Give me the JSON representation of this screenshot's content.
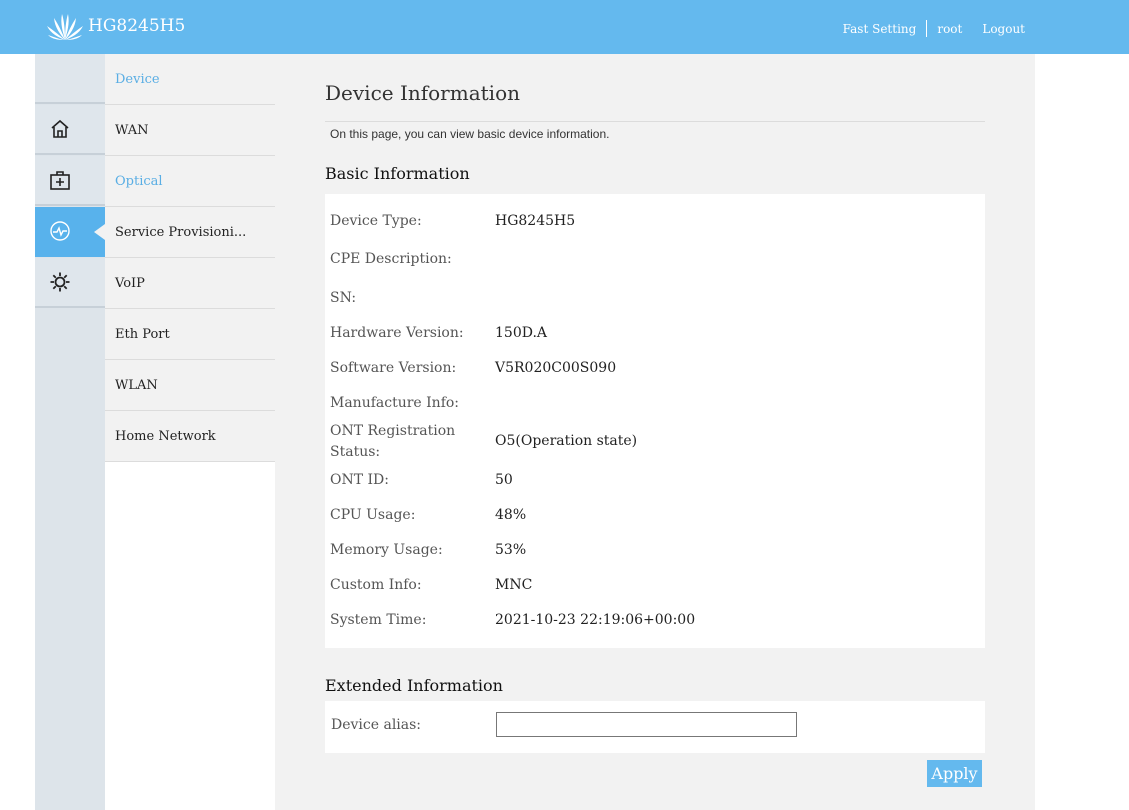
{
  "header": {
    "brand": "HG8245H5",
    "links": [
      "Fast Setting",
      "root",
      "Logout"
    ],
    "bg_color": "#64b9ee"
  },
  "icon_rail": [
    {
      "icon": "home-icon",
      "active": false
    },
    {
      "icon": "medical-kit-icon",
      "active": false
    },
    {
      "icon": "heartbeat-icon",
      "active": true
    },
    {
      "icon": "gear-icon",
      "active": false
    }
  ],
  "nav": {
    "items": [
      {
        "label": "Device",
        "highlight": true
      },
      {
        "label": "WAN",
        "highlight": false
      },
      {
        "label": "Optical",
        "highlight": true
      },
      {
        "label": "Service Provisioni...",
        "highlight": false
      },
      {
        "label": "VoIP",
        "highlight": false
      },
      {
        "label": "Eth Port",
        "highlight": false
      },
      {
        "label": "WLAN",
        "highlight": false
      },
      {
        "label": "Home Network",
        "highlight": false
      }
    ]
  },
  "page": {
    "title": "Device Information",
    "description": "On this page, you can view basic device information."
  },
  "basic": {
    "title": "Basic Information",
    "rows": [
      {
        "label": "Device Type:",
        "value": "HG8245H5"
      },
      {
        "label": "CPE Description:",
        "value": ""
      },
      {
        "label": "SN:",
        "value": ""
      },
      {
        "label": "Hardware Version:",
        "value": "150D.A"
      },
      {
        "label": "Software Version:",
        "value": "V5R020C00S090"
      },
      {
        "label": "Manufacture Info:",
        "value": ""
      },
      {
        "label": "ONT Registration Status:",
        "value": "O5(Operation state)"
      },
      {
        "label": "ONT ID:",
        "value": "50"
      },
      {
        "label": "CPU Usage:",
        "value": "48%"
      },
      {
        "label": "Memory Usage:",
        "value": "53%"
      },
      {
        "label": "Custom Info:",
        "value": "MNC"
      },
      {
        "label": "System Time:",
        "value": "2021-10-23 22:19:06+00:00"
      }
    ]
  },
  "extended": {
    "title": "Extended Information",
    "alias_label": "Device alias:",
    "alias_value": ""
  },
  "apply_label": "Apply",
  "accent_color": "#5aaee4"
}
